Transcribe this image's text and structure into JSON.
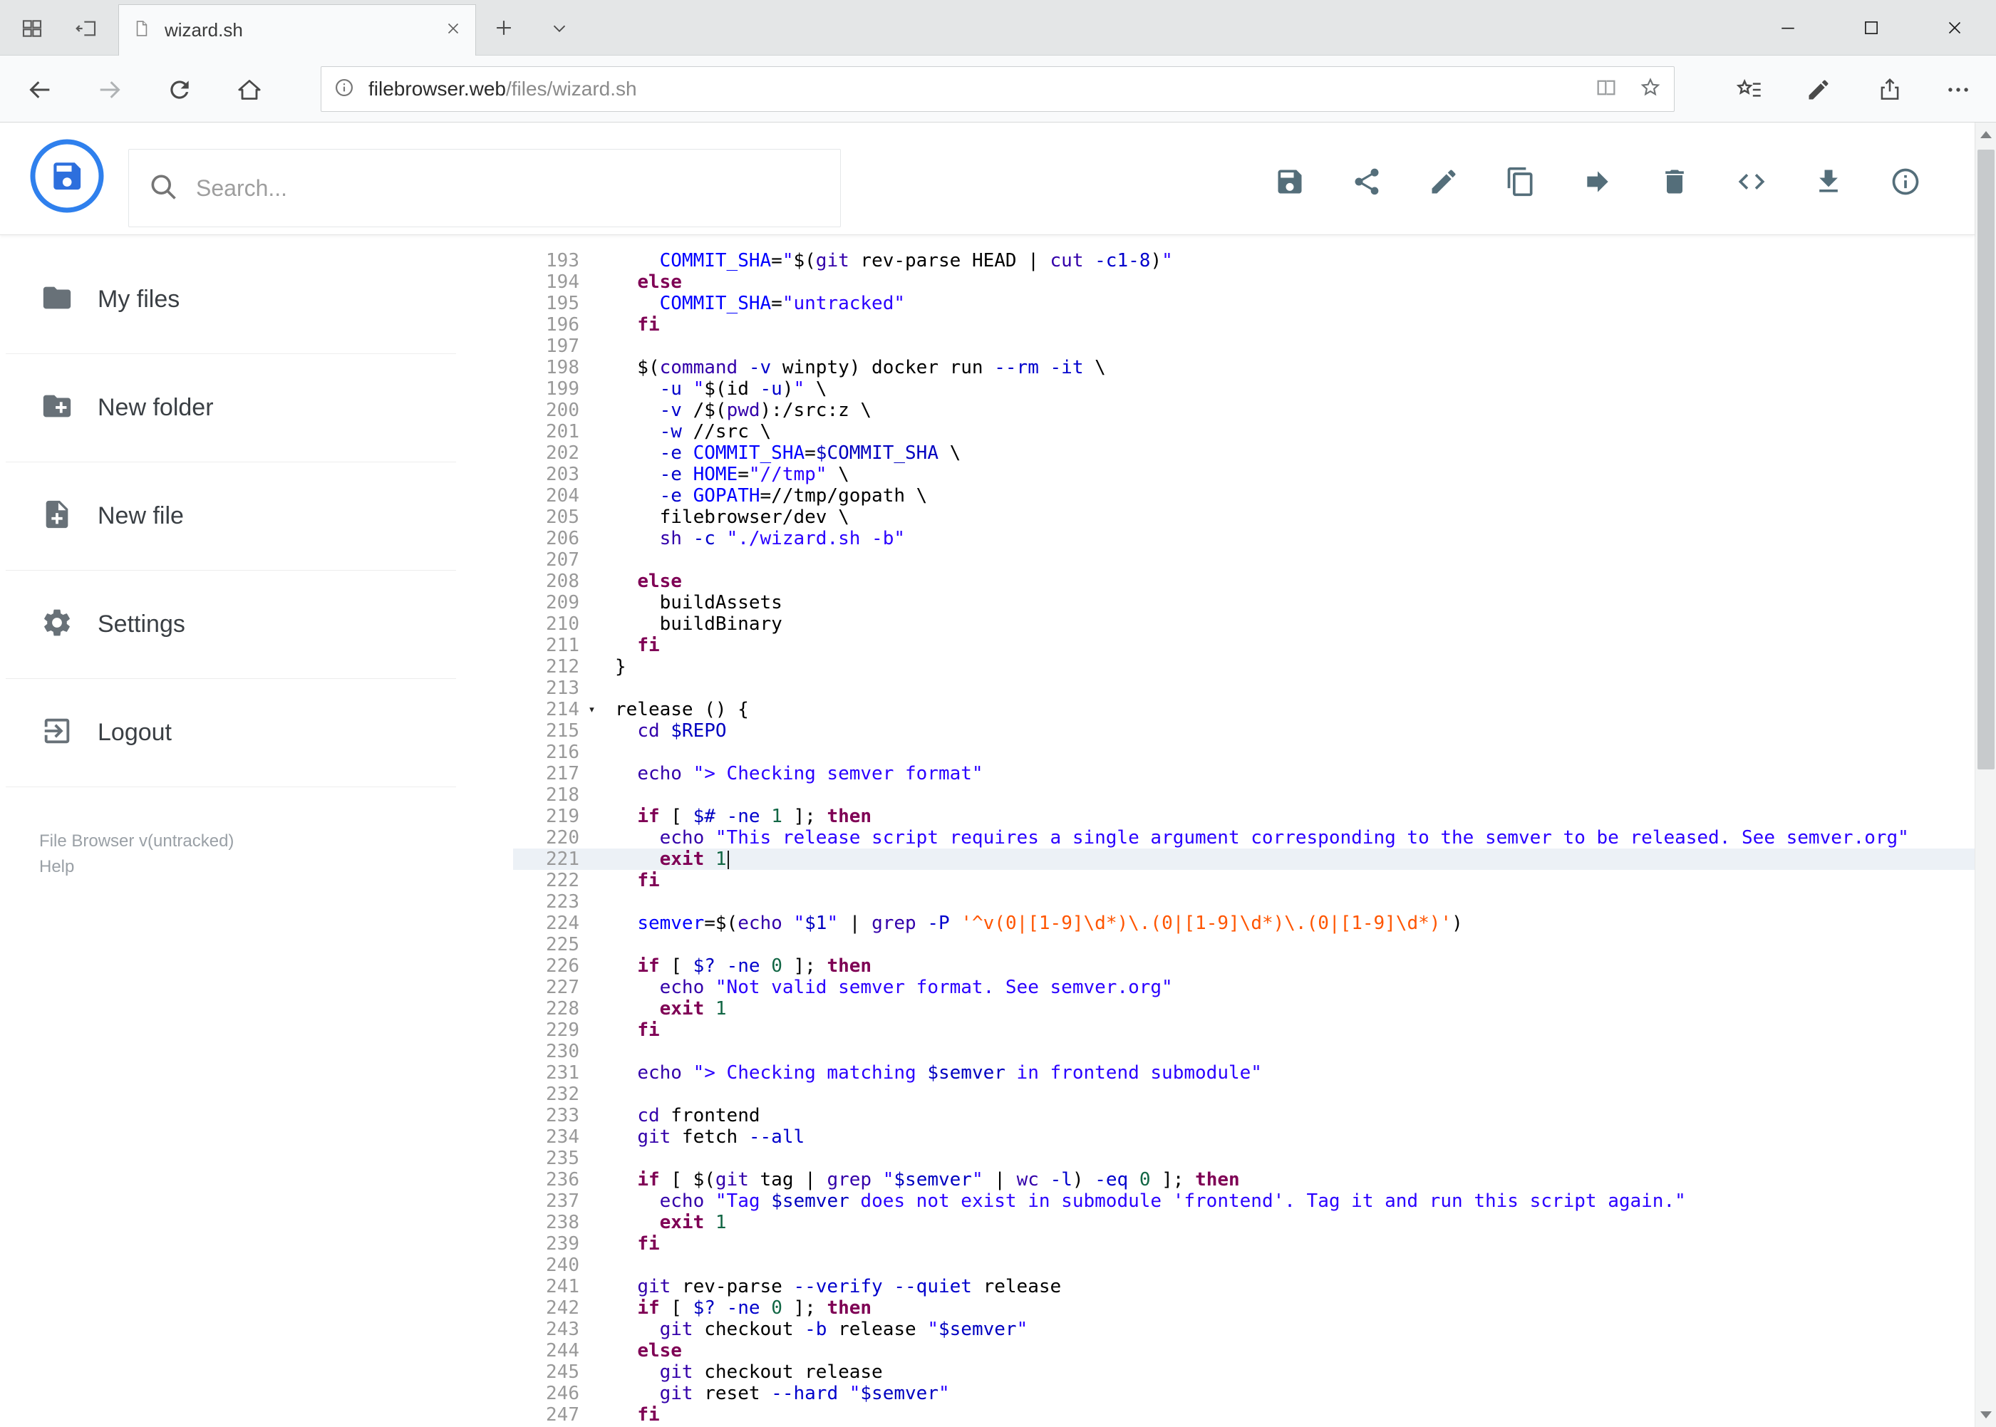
{
  "window": {
    "tab_title": "wizard.sh"
  },
  "navbar": {
    "url_host": "filebrowser.web",
    "url_path": "/files/wizard.sh"
  },
  "header": {
    "search_placeholder": "Search...",
    "toolbar": [
      {
        "name": "save",
        "icon": "save-icon"
      },
      {
        "name": "share",
        "icon": "share-icon"
      },
      {
        "name": "edit",
        "icon": "edit-icon"
      },
      {
        "name": "copy",
        "icon": "copy-icon"
      },
      {
        "name": "move",
        "icon": "move-icon"
      },
      {
        "name": "delete",
        "icon": "delete-icon"
      },
      {
        "name": "code",
        "icon": "code-icon"
      },
      {
        "name": "download",
        "icon": "download-icon"
      },
      {
        "name": "info",
        "icon": "info-icon"
      }
    ]
  },
  "sidebar": {
    "items": [
      {
        "label": "My files",
        "icon": "folder"
      },
      {
        "label": "New folder",
        "icon": "newfolder"
      },
      {
        "label": "New file",
        "icon": "newfile"
      },
      {
        "label": "Settings",
        "icon": "settings"
      },
      {
        "label": "Logout",
        "icon": "logout"
      }
    ],
    "footer_version": "File Browser v(untracked)",
    "footer_help": "Help"
  },
  "colors": {
    "brand_blue": "#2f80ed",
    "icon_gray": "#546e7a",
    "active_line": "#ecf1f6"
  },
  "editor": {
    "first_line": 193,
    "active_line": 221,
    "cursor_line": 221,
    "fold_line": 214,
    "lines": [
      "    COMMIT_SHA=\"$(git rev-parse HEAD | cut -c1-8)\"",
      "  else",
      "    COMMIT_SHA=\"untracked\"",
      "  fi",
      "",
      "  $(command -v winpty) docker run --rm -it \\",
      "    -u \"$(id -u)\" \\",
      "    -v /$(pwd):/src:z \\",
      "    -w //src \\",
      "    -e COMMIT_SHA=$COMMIT_SHA \\",
      "    -e HOME=\"//tmp\" \\",
      "    -e GOPATH=//tmp/gopath \\",
      "    filebrowser/dev \\",
      "    sh -c \"./wizard.sh -b\"",
      "",
      "  else",
      "    buildAssets",
      "    buildBinary",
      "  fi",
      "}",
      "",
      "release () {",
      "  cd $REPO",
      "",
      "  echo \"> Checking semver format\"",
      "",
      "  if [ $# -ne 1 ]; then",
      "    echo \"This release script requires a single argument corresponding to the semver to be released. See semver.org\"",
      "    exit 1",
      "  fi",
      "",
      "  semver=$(echo \"$1\" | grep -P '^v(0|[1-9]\\d*)\\.(0|[1-9]\\d*)\\.(0|[1-9]\\d*)')",
      "",
      "  if [ $? -ne 0 ]; then",
      "    echo \"Not valid semver format. See semver.org\"",
      "    exit 1",
      "  fi",
      "",
      "  echo \"> Checking matching $semver in frontend submodule\"",
      "",
      "  cd frontend",
      "  git fetch --all",
      "",
      "  if [ $(git tag | grep \"$semver\" | wc -l) -eq 0 ]; then",
      "    echo \"Tag $semver does not exist in submodule 'frontend'. Tag it and run this script again.\"",
      "    exit 1",
      "  fi",
      "",
      "  git rev-parse --verify --quiet release",
      "  if [ $? -ne 0 ]; then",
      "    git checkout -b release \"$semver\"",
      "  else",
      "    git checkout release",
      "    git reset --hard \"$semver\"",
      "  fi"
    ]
  }
}
